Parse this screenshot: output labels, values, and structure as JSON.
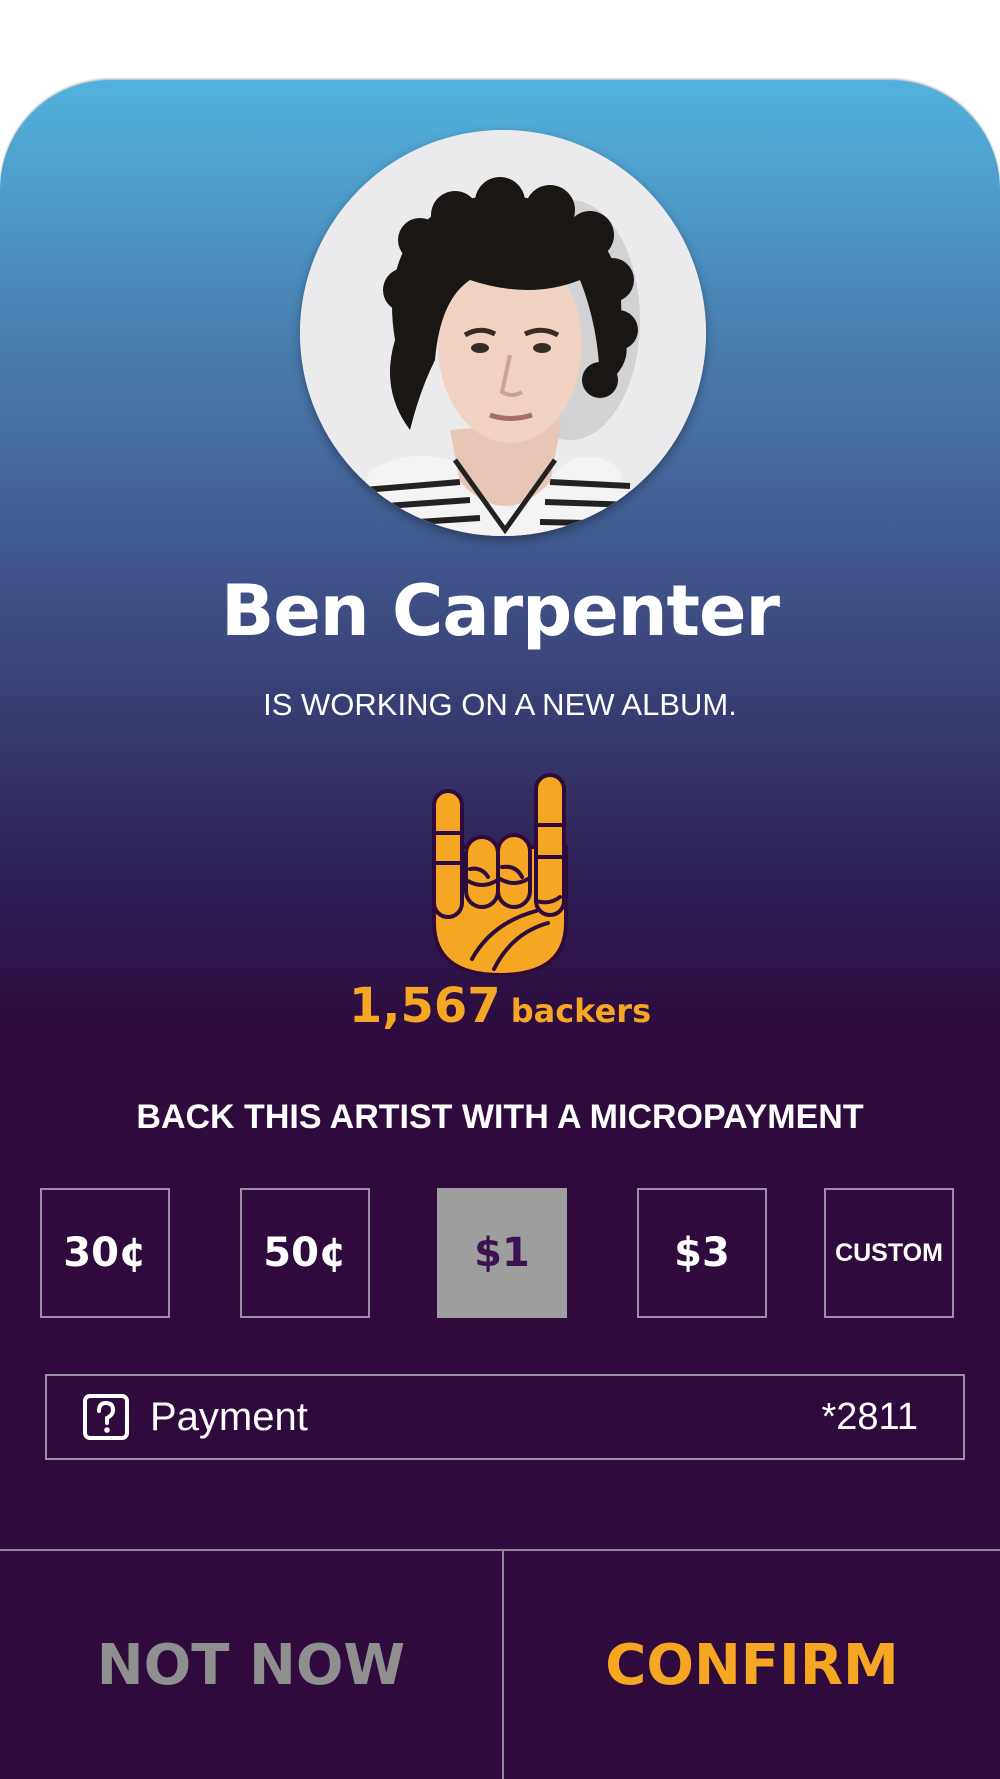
{
  "artist": {
    "name": "Ben Carpenter",
    "status": "IS WORKING ON A NEW ALBUM.",
    "avatar_icon": "artist-portrait"
  },
  "backers": {
    "count": "1,567",
    "label": "backers",
    "icon": "rock-hand-icon"
  },
  "micropayment": {
    "title": "BACK THIS ARTIST WITH A MICROPAYMENT",
    "options": [
      "30¢",
      "50¢",
      "$1",
      "$3",
      "CUSTOM"
    ],
    "selected": "$1"
  },
  "payment": {
    "label": "Payment",
    "card": "*2811",
    "icon": "question-icon"
  },
  "actions": {
    "not_now": "NOT NOW",
    "confirm": "CONFIRM"
  },
  "colors": {
    "accent": "#f5a623",
    "background_dark": "#2e0a3d",
    "gradient_top": "#52b2dd",
    "selected_bg": "#9e9e9e",
    "muted": "#8f8f8f"
  }
}
